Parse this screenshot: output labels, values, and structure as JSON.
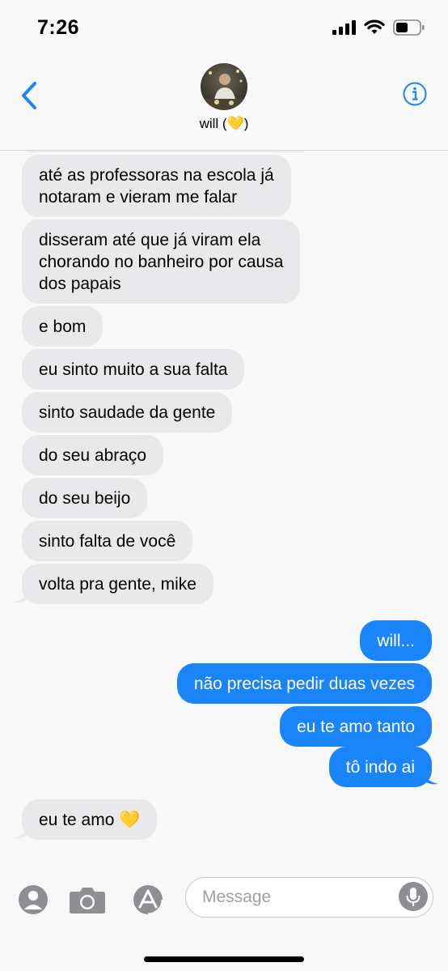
{
  "status_bar": {
    "time": "7:26"
  },
  "header": {
    "contact_name": "will (💛)"
  },
  "messages": [
    {
      "dir": "in",
      "text": "até as professoras na escola já\nnotaram e vieram me falar"
    },
    {
      "dir": "in",
      "text": "disseram até que já viram ela\nchorando no banheiro por causa\ndos papais"
    },
    {
      "dir": "in",
      "text": "e bom"
    },
    {
      "dir": "in",
      "text": "eu sinto muito a sua falta"
    },
    {
      "dir": "in",
      "text": "sinto saudade da gente"
    },
    {
      "dir": "in",
      "text": "do seu abraço"
    },
    {
      "dir": "in",
      "text": "do seu beijo"
    },
    {
      "dir": "in",
      "text": "sinto falta de você"
    },
    {
      "dir": "in",
      "text": "volta pra gente, mike"
    },
    {
      "dir": "out",
      "text": "will..."
    },
    {
      "dir": "out",
      "text": "não precisa pedir duas vezes"
    },
    {
      "dir": "out",
      "text": "eu te amo tanto"
    },
    {
      "dir": "out",
      "text": "tô indo ai"
    },
    {
      "dir": "in",
      "text": "eu te amo 💛"
    }
  ],
  "input_bar": {
    "placeholder": "Message"
  },
  "colors": {
    "accent": "#1a84f9",
    "incoming_bubble": "#e9e9eb",
    "background": "#f8f8f9"
  }
}
